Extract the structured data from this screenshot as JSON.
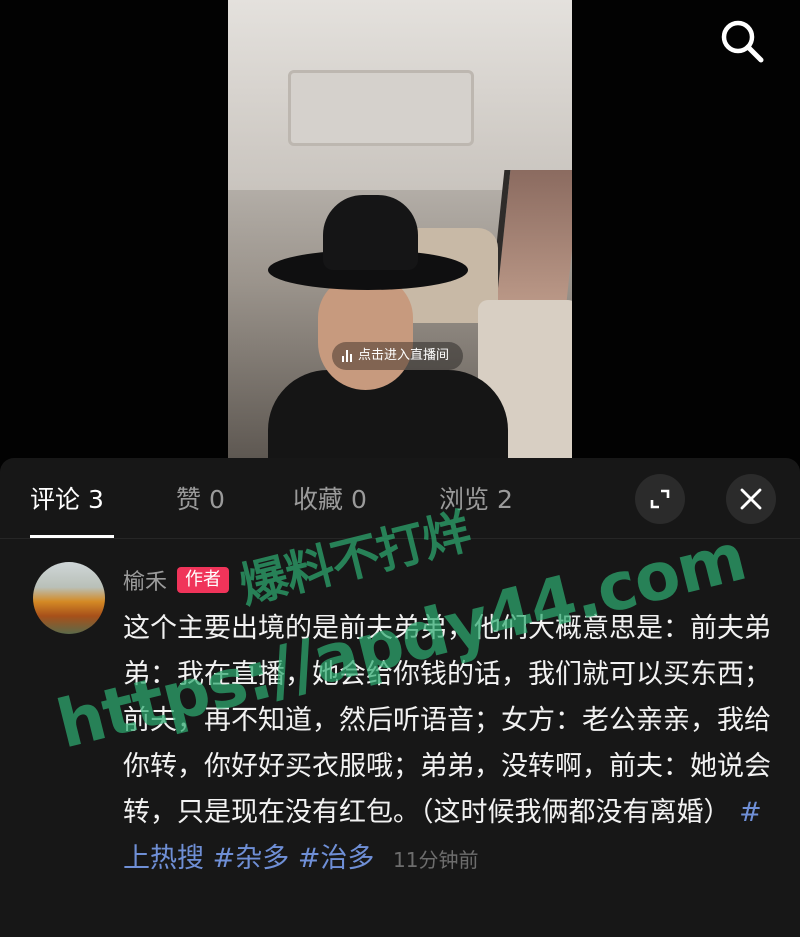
{
  "video": {
    "live_prompt": "点击进入直播间"
  },
  "panel": {
    "tabs": [
      {
        "label": "评论 3",
        "active": true
      },
      {
        "label": "赞 0",
        "active": false
      },
      {
        "label": "收藏 0",
        "active": false
      },
      {
        "label": "浏览 2",
        "active": false
      }
    ]
  },
  "comment": {
    "author": "榆禾",
    "badge": "作者",
    "text": "这个主要出境的是前夫弟弟，他们大概意思是：前夫弟弟：我在直播，她会给你钱的话，我们就可以买东西；前夫，再不知道，然后听语音；女方：老公亲亲，我给你转，你好好买衣服哦；弟弟，没转啊，前夫：她说会转，只是现在没有红包。（这时候我俩都没有离婚）",
    "hashtags": [
      "#上热搜",
      "#杂多",
      "#治多"
    ],
    "time": "11分钟前"
  },
  "watermark": {
    "cn": "爆料不打烊",
    "url": "https://apdy44.com"
  },
  "colors": {
    "panel_bg": "#171717",
    "badge": "#f0345a",
    "hashtag": "#6f8fd6",
    "watermark": "#2eaa70"
  }
}
